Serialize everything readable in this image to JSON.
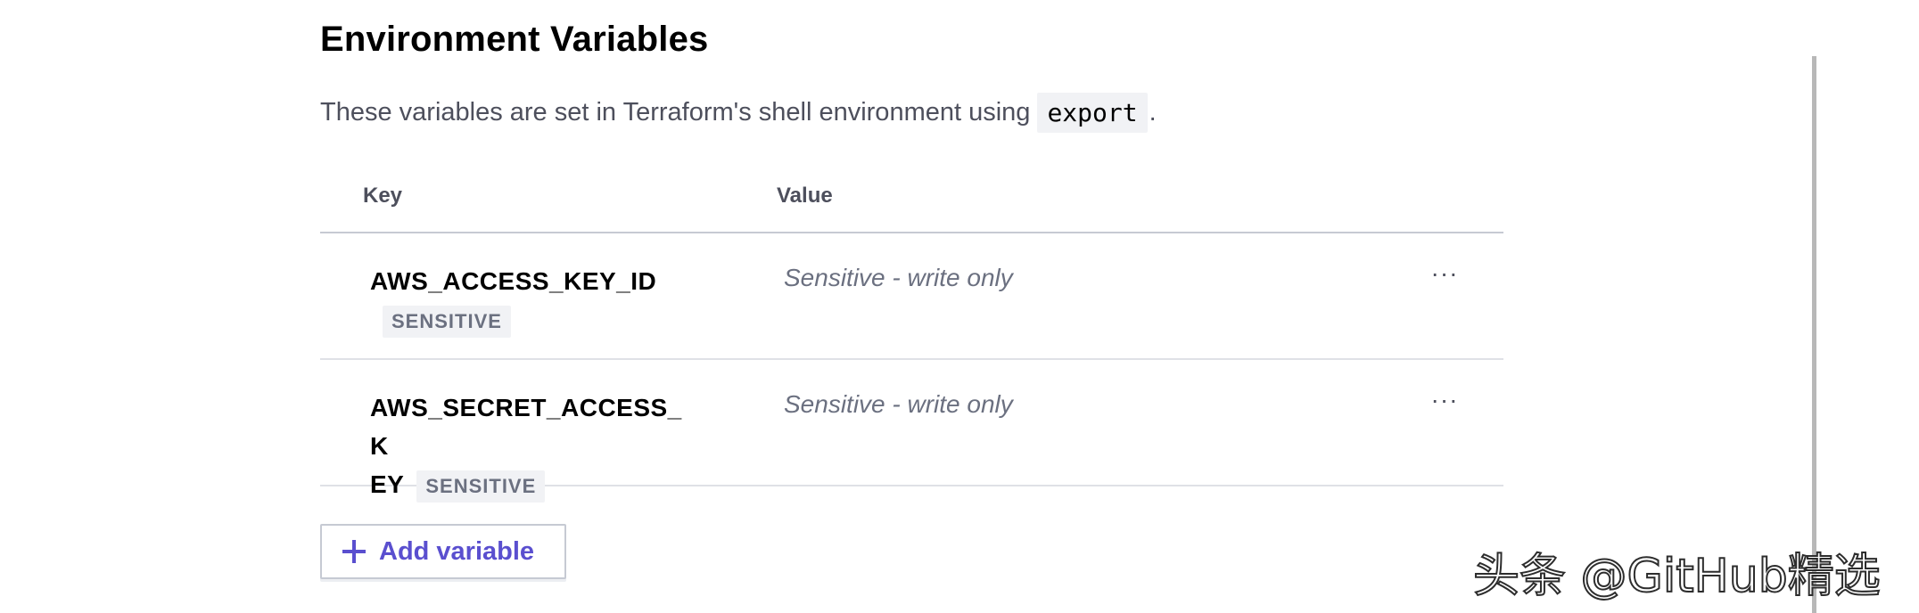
{
  "section": {
    "title": "Environment Variables",
    "description_prefix": "These variables are set in Terraform's shell environment using",
    "description_code": "export",
    "description_suffix": "."
  },
  "table": {
    "headers": {
      "key": "Key",
      "value": "Value"
    },
    "rows": [
      {
        "key": "AWS_ACCESS_KEY_ID",
        "badge": "SENSITIVE",
        "value": "Sensitive - write only",
        "menu_icon": "ellipsis-icon",
        "menu_label": "···"
      },
      {
        "key_line1": "AWS_SECRET_ACCESS_K",
        "key_line2": "EY",
        "badge": "SENSITIVE",
        "value": "Sensitive - write only",
        "menu_icon": "ellipsis-icon",
        "menu_label": "···"
      }
    ]
  },
  "add_button": {
    "label": "Add variable",
    "icon": "plus-icon",
    "color": "#5a4fcf"
  },
  "watermark": "头条 @GitHub精选"
}
